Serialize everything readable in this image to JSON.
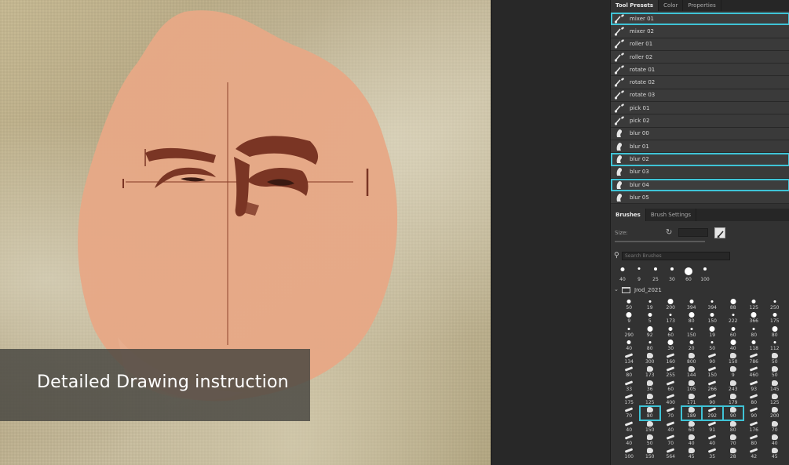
{
  "caption": "Detailed Drawing instruction",
  "panel": {
    "tabs": [
      "Tool Presets",
      "Color",
      "Properties"
    ],
    "presets": [
      {
        "label": "mixer 01",
        "icon": "brush-icon",
        "highlighted": true
      },
      {
        "label": "mixer 02",
        "icon": "brush-icon",
        "highlighted": false
      },
      {
        "label": "roller 01",
        "icon": "brush-icon",
        "highlighted": false
      },
      {
        "label": "roller 02",
        "icon": "brush-icon",
        "highlighted": false
      },
      {
        "label": "rotate 01",
        "icon": "brush-icon",
        "highlighted": false
      },
      {
        "label": "rotate 02",
        "icon": "brush-icon",
        "highlighted": false
      },
      {
        "label": "rotate 03",
        "icon": "brush-icon",
        "highlighted": false
      },
      {
        "label": "pick 01",
        "icon": "brush-icon",
        "highlighted": false
      },
      {
        "label": "pick 02",
        "icon": "brush-icon",
        "highlighted": false
      },
      {
        "label": "blur 00",
        "icon": "smudge-icon",
        "highlighted": false
      },
      {
        "label": "blur 01",
        "icon": "smudge-icon",
        "highlighted": false
      },
      {
        "label": "blur 02",
        "icon": "smudge-icon",
        "highlighted": true
      },
      {
        "label": "blur 03",
        "icon": "smudge-icon",
        "highlighted": false
      },
      {
        "label": "blur 04",
        "icon": "smudge-icon",
        "highlighted": true
      },
      {
        "label": "blur 05",
        "icon": "smudge-icon",
        "highlighted": false
      }
    ],
    "brushes_tabs": [
      "Brushes",
      "Brush Settings"
    ],
    "size_label": "Size:",
    "search_placeholder": "Search Brushes",
    "recent_brushes": [
      "40",
      "9",
      "25",
      "30",
      "60",
      "100"
    ],
    "folder_name": "Jrod_2021",
    "brush_grid": [
      "50",
      "19",
      "200",
      "394",
      "394",
      "88",
      "125",
      "250",
      "9",
      "5",
      "173",
      "80",
      "150",
      "222",
      "366",
      "175",
      "290",
      "92",
      "60",
      "150",
      "19",
      "60",
      "80",
      "80",
      "40",
      "80",
      "30",
      "20",
      "50",
      "40",
      "118",
      "112",
      "134",
      "300",
      "160",
      "800",
      "90",
      "150",
      "786",
      "50",
      "80",
      "173",
      "255",
      "144",
      "150",
      "9",
      "460",
      "50",
      "33",
      "36",
      "60",
      "105",
      "266",
      "243",
      "93",
      "145",
      "175",
      "125",
      "400",
      "171",
      "90",
      "179",
      "80",
      "125",
      "70",
      "80",
      "70",
      "189",
      "292",
      "90",
      "90",
      "200",
      "40",
      "150",
      "40",
      "60",
      "91",
      "80",
      "176",
      "70",
      "40",
      "50",
      "70",
      "40",
      "40",
      "70",
      "80",
      "40",
      "100",
      "150",
      "564",
      "45",
      "35",
      "28",
      "42",
      "45"
    ],
    "highlighted_grid_cells": [
      65,
      67,
      68,
      69
    ]
  },
  "colors": {
    "highlight": "#3fc3d6",
    "skin": "#e6a886",
    "paint": "#7a3524"
  }
}
